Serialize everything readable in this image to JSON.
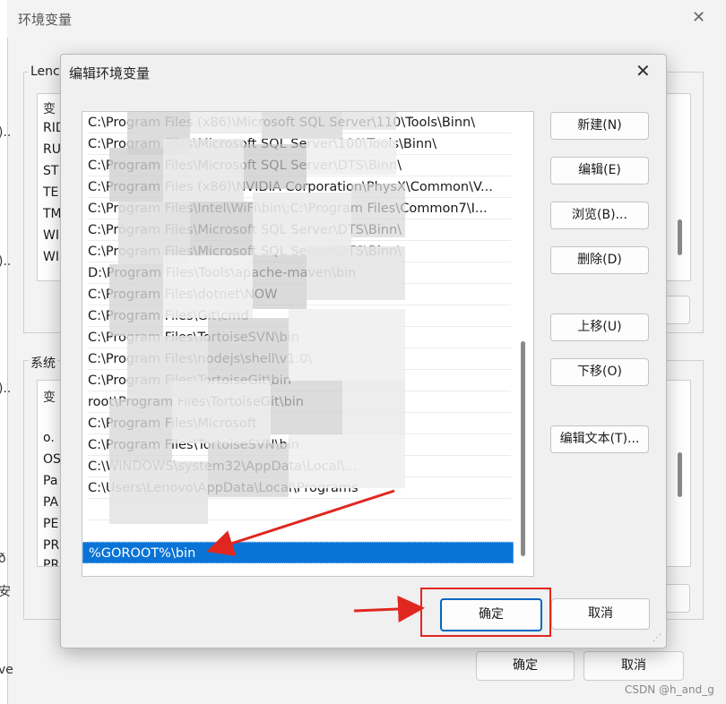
{
  "background_window": {
    "title": "环境变量",
    "user_group_label": "Lenc",
    "system_group_label": "系统",
    "user_list_header": "变",
    "user_rows": [
      "RID",
      "RU",
      "ST",
      "TE",
      "TM",
      "WI",
      "WI"
    ],
    "system_list_header": "变",
    "system_rows": [
      "o.",
      "OS",
      "Pa",
      "PA",
      "PE",
      "PR",
      "PR"
    ],
    "left_edge_fragments": [
      ")..",
      ")..",
      ")..",
      "ð",
      "安",
      "ve"
    ],
    "ok_label": "确定",
    "cancel_label": "取消"
  },
  "dialog": {
    "title": "编辑环境变量",
    "close_glyph": "✕",
    "path_rows": [
      "C:\\Program Files (x86)\\Microsoft SQL Server\\110\\Tools\\Binn\\",
      "C:\\Program Files\\Microsoft SQL Server\\100\\Tools\\Binn\\",
      "C:\\Program Files\\Microsoft SQL Server\\DTS\\Binn\\",
      "C:\\Program Files (x86)\\NVIDIA Corporation\\PhysX\\Common\\V...",
      "C:\\Program Files\\Intel\\WiFi\\bin\\;C:\\Program Files\\Common7\\I...",
      "C:\\Program Files\\Microsoft SQL Server\\DTS\\Binn\\",
      "C:\\Program Files\\Microsoft SQL Server\\DTS\\Binn\\",
      "D:\\Program Files\\Tools\\apache-maven\\bin",
      "C:\\Program Files\\dotnet\\NOW",
      "C:\\Program Files\\Git\\cmd",
      "C:\\Program Files\\TortoiseSVN\\bin",
      "C:\\Program Files\\nodejs\\shell\\v1.0\\",
      "C:\\Program Files\\TortoiseGit\\bin",
      "root\\Program Files\\TortoiseGit\\bin",
      "C:\\Program Files\\Microsoft",
      "C:\\Program Files\\TortoiseSVN\\bin",
      "C:\\WINDOWS\\system32\\AppData\\Local\\...",
      "C:\\Users\\Lenovo\\AppData\\Local\\Programs",
      "",
      "",
      "%GOROOT%\\bin"
    ],
    "selected_row": "%GOROOT%\\bin",
    "buttons": {
      "new": "新建(N)",
      "edit": "编辑(E)",
      "browse": "浏览(B)...",
      "delete": "删除(D)",
      "move_up": "上移(U)",
      "move_down": "下移(O)",
      "edit_text": "编辑文本(T)..."
    },
    "ok_label": "确定",
    "cancel_label": "取消",
    "grip_glyph": "⋰"
  },
  "watermark": "CSDN @h_and_g",
  "colors": {
    "selection": "#0a73d6",
    "annotation_red": "#e0271f",
    "ok_border": "#0067c0"
  }
}
